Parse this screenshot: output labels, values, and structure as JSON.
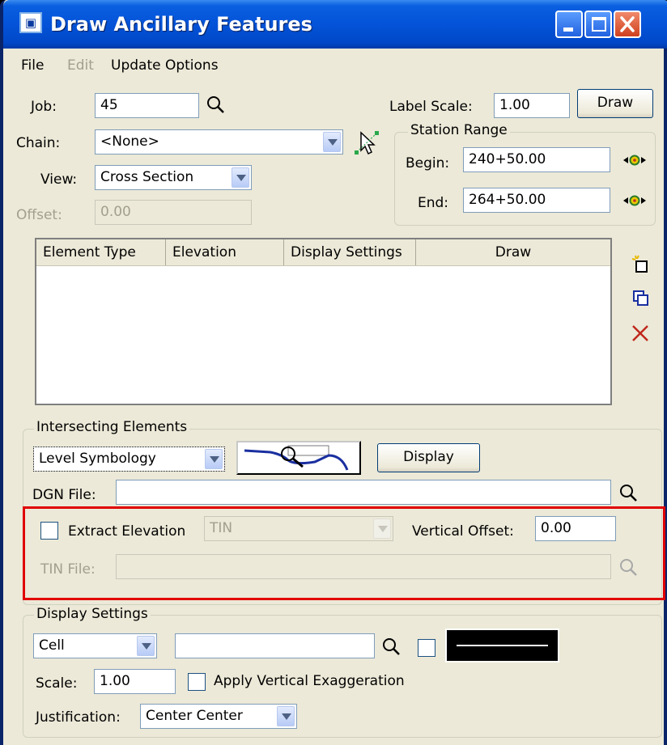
{
  "window": {
    "title": "Draw Ancillary Features",
    "app_icon_text": "▣"
  },
  "menu": [
    {
      "label": "File",
      "enabled": true
    },
    {
      "label": "Edit",
      "enabled": false
    },
    {
      "label": "Update Options",
      "enabled": true
    }
  ],
  "top": {
    "job_label": "Job:",
    "job_value": "45",
    "label_scale_label": "Label Scale:",
    "label_scale_value": "1.00",
    "draw_button": "Draw",
    "chain_label": "Chain:",
    "chain_value": "<None>",
    "view_label": "View:",
    "view_value": "Cross Section",
    "offset_label": "Offset:",
    "offset_value": "0.00"
  },
  "station_range": {
    "title": "Station Range",
    "begin_label": "Begin:",
    "begin_value": "240+50.00",
    "end_label": "End:",
    "end_value": "264+50.00"
  },
  "element_list": {
    "columns": [
      "Element Type",
      "Elevation",
      "Display Settings",
      "Draw"
    ],
    "rows": []
  },
  "intersecting": {
    "title": "Intersecting Elements",
    "symbology_value": "Level Symbology",
    "display_button": "Display",
    "dgn_label": "DGN File:",
    "dgn_value": "",
    "extract_label": "Extract Elevation",
    "extract_checked": false,
    "extract_source": "TIN",
    "vertical_offset_label": "Vertical Offset:",
    "vertical_offset_value": "0.00",
    "tin_label": "TIN File:",
    "tin_value": ""
  },
  "display_settings": {
    "title": "Display Settings",
    "type_value": "Cell",
    "cell_value": "",
    "scale_label": "Scale:",
    "scale_value": "1.00",
    "apply_vertical_label": "Apply Vertical Exaggeration",
    "apply_vertical_checked": false,
    "justification_label": "Justification:",
    "justification_value": "Center Center"
  },
  "colors": {
    "titlebar": "#0453d8",
    "dialog_bg": "#ece9d8",
    "highlight": "#e00000",
    "accent_red": "#c0281c",
    "accent_blue": "#1a2fa0"
  }
}
